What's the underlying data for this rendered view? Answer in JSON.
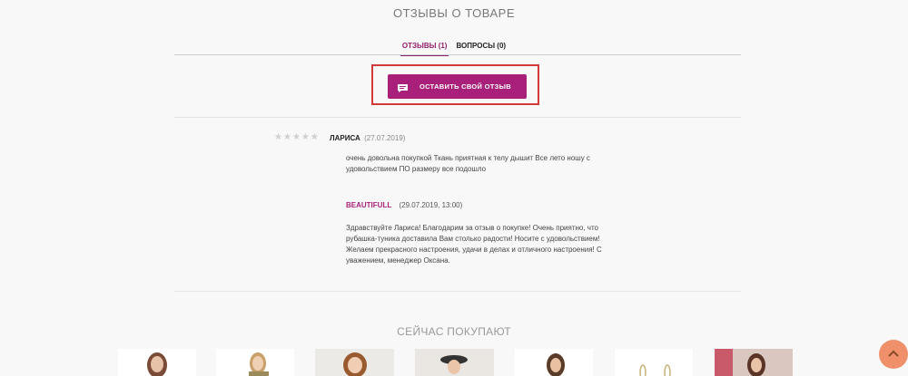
{
  "section": {
    "title": "ОТЗЫВЫ О ТОВАРЕ"
  },
  "tabs": [
    {
      "label": "ОТЗЫВЫ (1)",
      "active": true
    },
    {
      "label": "ВОПРОСЫ (0)",
      "active": false
    }
  ],
  "review_button": {
    "label": "ОСТАВИТЬ СВОЙ ОТЗЫВ",
    "icon": "chat-bubble-icon",
    "color": "#a8207a"
  },
  "highlight_color": "#d23a3a",
  "review": {
    "rating": 0,
    "rating_max": 5,
    "author": "ЛАРИСА",
    "date": "(27.07.2019)",
    "text": "очень довольна покупкой Ткань приятная к телу дышит Все лето ношу с удовольствием ПО размеру все подошло"
  },
  "reply": {
    "author": "BEAUTIFULL",
    "date": "(29.07.2019, 13:00)",
    "text": "Здравствуйте Лариса! Благодарим за отзыв о покупке! Очень приятно, что рубашка-туника доставила Вам столько радости! Носите с удовольствием! Желаем прекрасного настроения, удачи в делах и отличного настроения! С уважением, менеджер Оксана."
  },
  "buying_now": {
    "title": "СЕЙЧАС ПОКУПАЮТ"
  },
  "scroll_top": {
    "icon": "chevron-up-icon",
    "color": "#f0906a"
  }
}
